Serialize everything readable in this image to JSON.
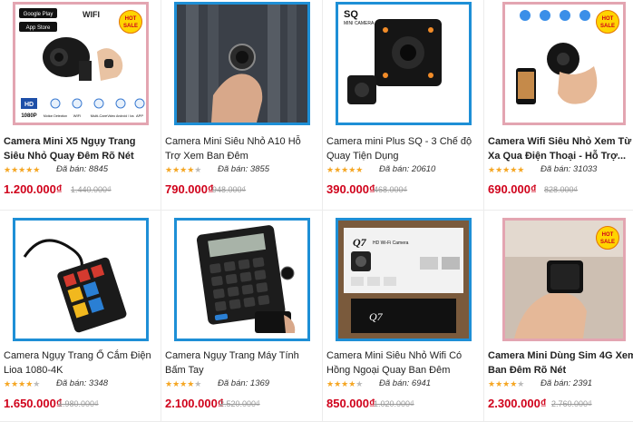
{
  "products": [
    {
      "title": "Camera Mini X5 Ngụy Trang Siêu Nhỏ Quay Đêm Rõ Nét",
      "sold": "Đã bán: 8845",
      "price": "1.200.000₫",
      "old_price": "1.440.000₫",
      "bold": true,
      "hot": "HOT SALE",
      "stars": 5
    },
    {
      "title": "Camera Mini Siêu Nhỏ A10 Hỗ Trợ Xem Ban Đêm",
      "sold": "Đã bán: 3855",
      "price": "790.000₫",
      "old_price": "948.000₫",
      "bold": false,
      "stars": 4
    },
    {
      "title": "Camera mini Plus SQ - 3 Chế độ Quay Tiện Dụng",
      "sold": "Đã bán: 20610",
      "price": "390.000₫",
      "old_price": "468.000₫",
      "bold": false,
      "stars": 5
    },
    {
      "title": "Camera Wifi Siêu Nhỏ Xem Từ Xa Qua Điện Thoại - Hỗ Trợ...",
      "sold": "Đã bán: 31033",
      "price": "690.000₫",
      "old_price": "828.000₫",
      "bold": true,
      "hot": "HOT SALE",
      "stars": 5
    },
    {
      "title": "Camera Ngụy Trang Ổ Cắm Điện Lioa 1080-4K",
      "sold": "Đã bán: 3348",
      "price": "1.650.000₫",
      "old_price": "1.980.000₫",
      "bold": false,
      "stars": 4
    },
    {
      "title": "Camera Ngụy Trang Máy Tính Bấm Tay",
      "sold": "Đã bán: 1369",
      "price": "2.100.000₫",
      "old_price": "2.520.000₫",
      "bold": false,
      "stars": 4
    },
    {
      "title": "Camera Mini Siêu Nhỏ Wifi Có Hồng Ngoại Quay Ban Đêm",
      "sold": "Đã bán: 6941",
      "price": "850.000₫",
      "old_price": "1.020.000₫",
      "bold": false,
      "stars": 4
    },
    {
      "title": "Camera Mini Dùng Sim 4G Xem Ban Đêm Rõ Nét",
      "sold": "Đã bán: 2391",
      "price": "2.300.000₫",
      "old_price": "2.760.000₫",
      "bold": true,
      "hot": "HOT SALE",
      "stars": 4
    }
  ],
  "thumb_text": {
    "google_play": "Google Play",
    "app_store": "App Store",
    "wifi": "WIFI",
    "hd": "HD",
    "res": "1080P",
    "motion": "Motion Detection",
    "wifi2": "WIFI",
    "multicare": "Multi-Care",
    "video": "Video Android / Ios",
    "app": "APP",
    "sq": "SQ",
    "mini_camera": "MINI CAMERA",
    "q7": "Q7",
    "hd_wifi": "HD Wi-Fi Camera"
  },
  "colors": {
    "price": "#d0021b",
    "star": "#f5a623",
    "frame": "#1e8fd6",
    "frame_pink": "#e3a5b1"
  }
}
